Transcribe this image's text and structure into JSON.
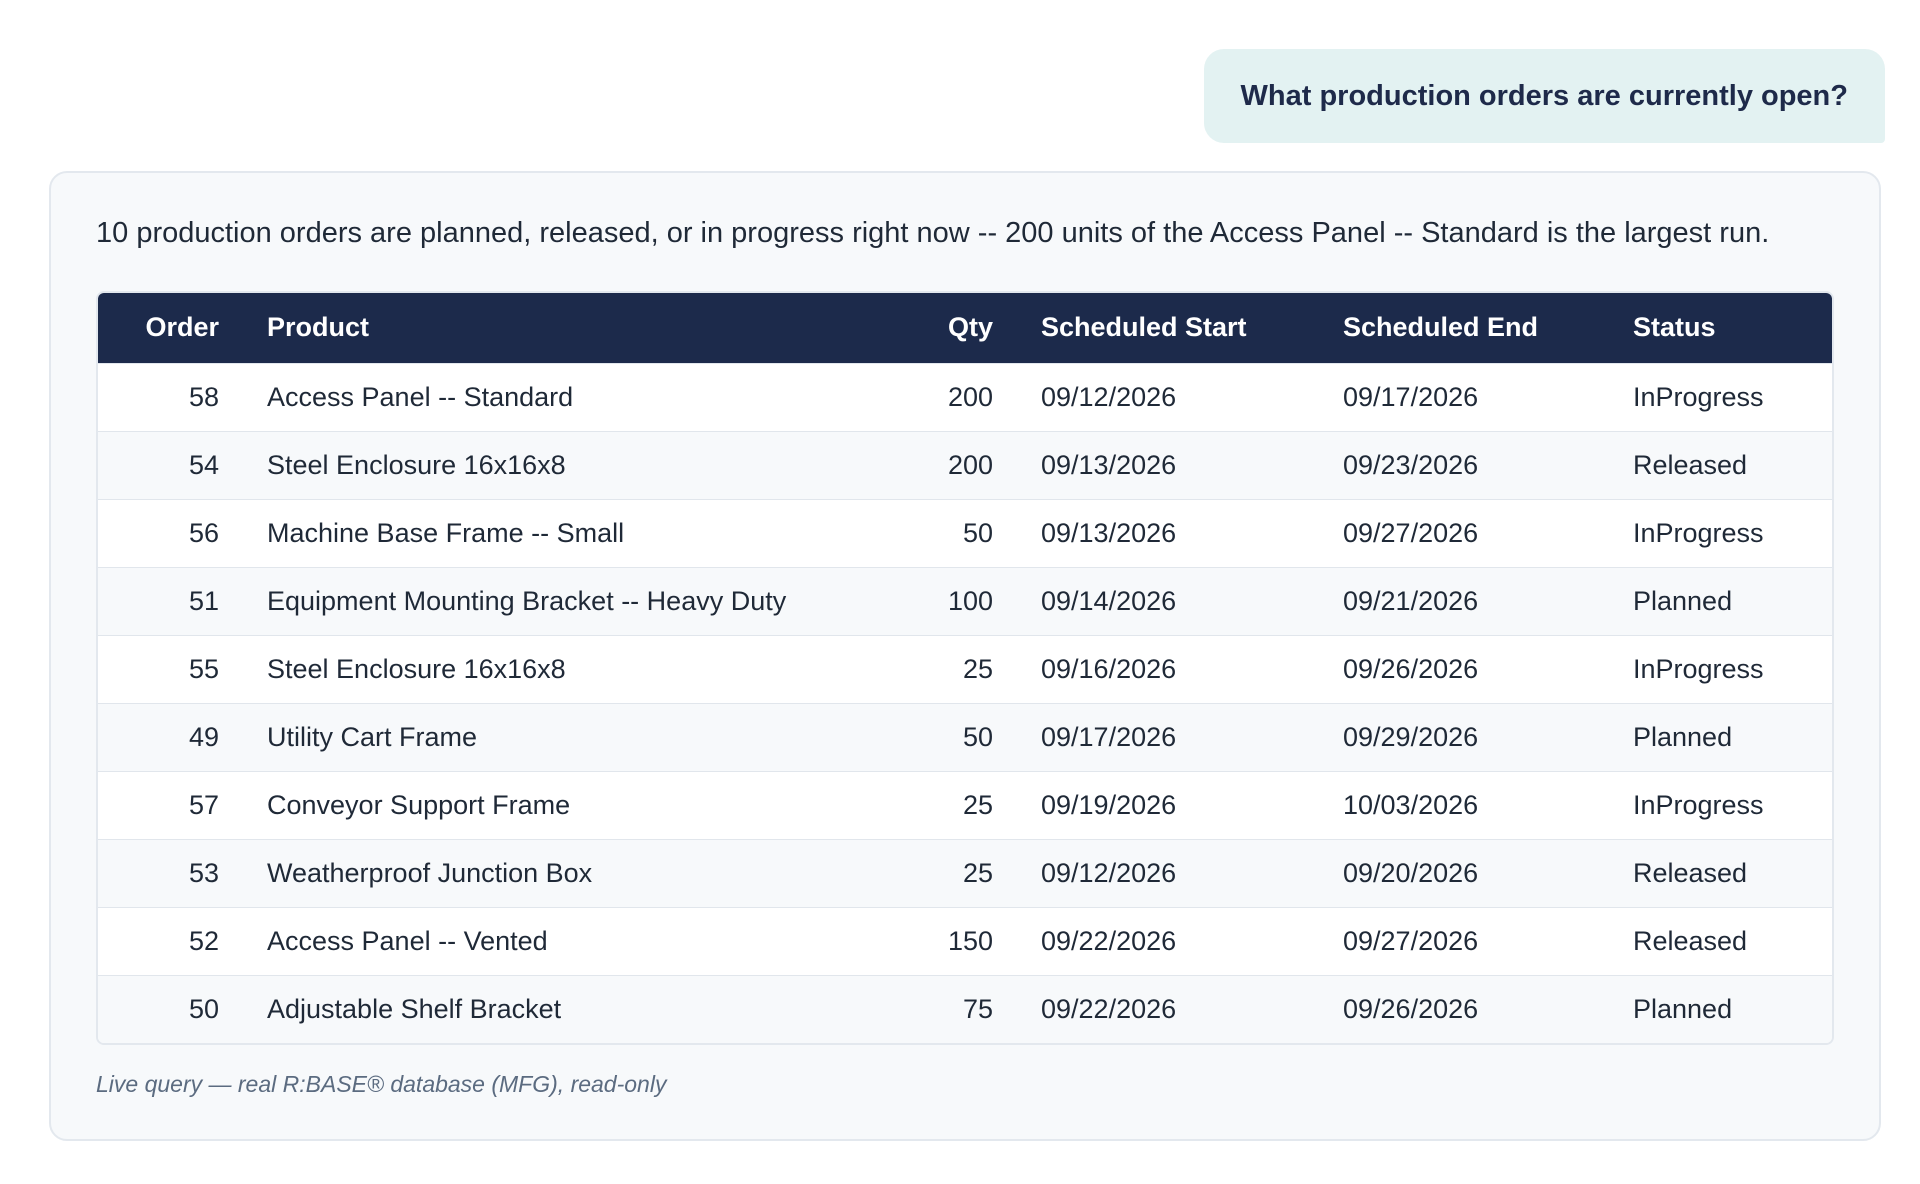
{
  "conversation": {
    "user_message": "What production orders are currently open?"
  },
  "answer": {
    "summary": "10 production orders are planned, released, or in progress right now -- 200 units of the Access Panel -- Standard is the largest run.",
    "table": {
      "headers": {
        "order": "Order",
        "product": "Product",
        "qty": "Qty",
        "start": "Scheduled Start",
        "end": "Scheduled End",
        "status": "Status"
      },
      "rows": [
        {
          "order": "58",
          "product": "Access Panel -- Standard",
          "qty": "200",
          "start": "09/12/2026",
          "end": "09/17/2026",
          "status": "InProgress"
        },
        {
          "order": "54",
          "product": "Steel Enclosure 16x16x8",
          "qty": "200",
          "start": "09/13/2026",
          "end": "09/23/2026",
          "status": "Released"
        },
        {
          "order": "56",
          "product": "Machine Base Frame -- Small",
          "qty": "50",
          "start": "09/13/2026",
          "end": "09/27/2026",
          "status": "InProgress"
        },
        {
          "order": "51",
          "product": "Equipment Mounting Bracket -- Heavy Duty",
          "qty": "100",
          "start": "09/14/2026",
          "end": "09/21/2026",
          "status": "Planned"
        },
        {
          "order": "55",
          "product": "Steel Enclosure 16x16x8",
          "qty": "25",
          "start": "09/16/2026",
          "end": "09/26/2026",
          "status": "InProgress"
        },
        {
          "order": "49",
          "product": "Utility Cart Frame",
          "qty": "50",
          "start": "09/17/2026",
          "end": "09/29/2026",
          "status": "Planned"
        },
        {
          "order": "57",
          "product": "Conveyor Support Frame",
          "qty": "25",
          "start": "09/19/2026",
          "end": "10/03/2026",
          "status": "InProgress"
        },
        {
          "order": "53",
          "product": "Weatherproof Junction Box",
          "qty": "25",
          "start": "09/12/2026",
          "end": "09/20/2026",
          "status": "Released"
        },
        {
          "order": "52",
          "product": "Access Panel -- Vented",
          "qty": "150",
          "start": "09/22/2026",
          "end": "09/27/2026",
          "status": "Released"
        },
        {
          "order": "50",
          "product": "Adjustable Shelf Bracket",
          "qty": "75",
          "start": "09/22/2026",
          "end": "09/26/2026",
          "status": "Planned"
        }
      ]
    },
    "footnote": "Live query — real R:BASE® database (MFG), read-only"
  },
  "colors": {
    "user_bubble_bg": "#e3f2f2",
    "header_bg": "#1c2a4b",
    "card_bg": "#f7f9fb"
  }
}
